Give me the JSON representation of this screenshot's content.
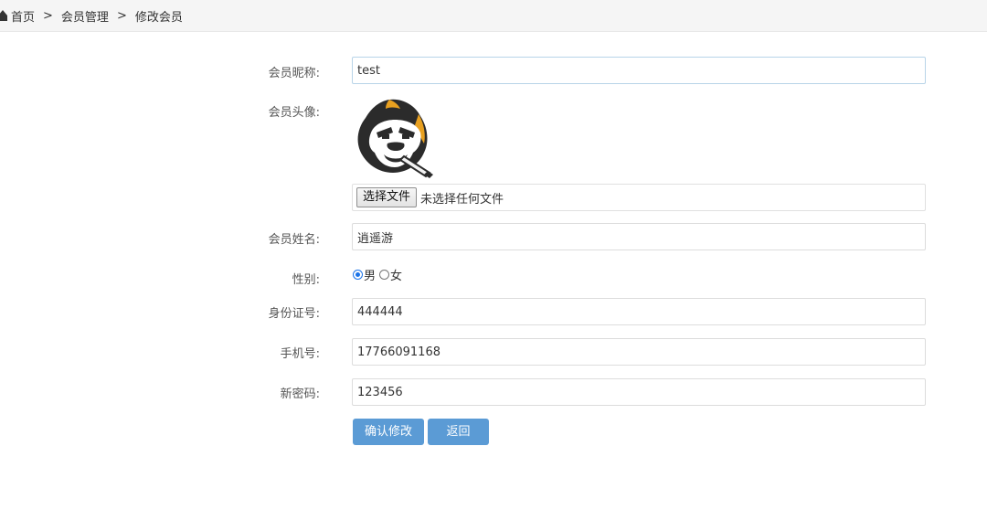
{
  "breadcrumb": {
    "items": [
      "首页",
      "会员管理",
      "修改会员"
    ],
    "separator": ">"
  },
  "form": {
    "nickname": {
      "label": "会员昵称:",
      "value": "test"
    },
    "avatar": {
      "label": "会员头像:",
      "icon": "gorilla-avatar-image"
    },
    "file": {
      "button_label": "选择文件",
      "status": "未选择任何文件"
    },
    "name": {
      "label": "会员姓名:",
      "value": "逍遥游"
    },
    "gender": {
      "label": "性别:",
      "options": [
        "男",
        "女"
      ],
      "selected": "男"
    },
    "id_number": {
      "label": "身份证号:",
      "value": "444444"
    },
    "phone": {
      "label": "手机号:",
      "value": "17766091168"
    },
    "password": {
      "label": "新密码:",
      "value": "123456"
    }
  },
  "buttons": {
    "confirm_label": "确认修改",
    "back_label": "返回"
  },
  "colors": {
    "primary_button": "#5b9bd5",
    "topbar": "#f5f5f5",
    "radio_checked": "#1a73e8"
  }
}
